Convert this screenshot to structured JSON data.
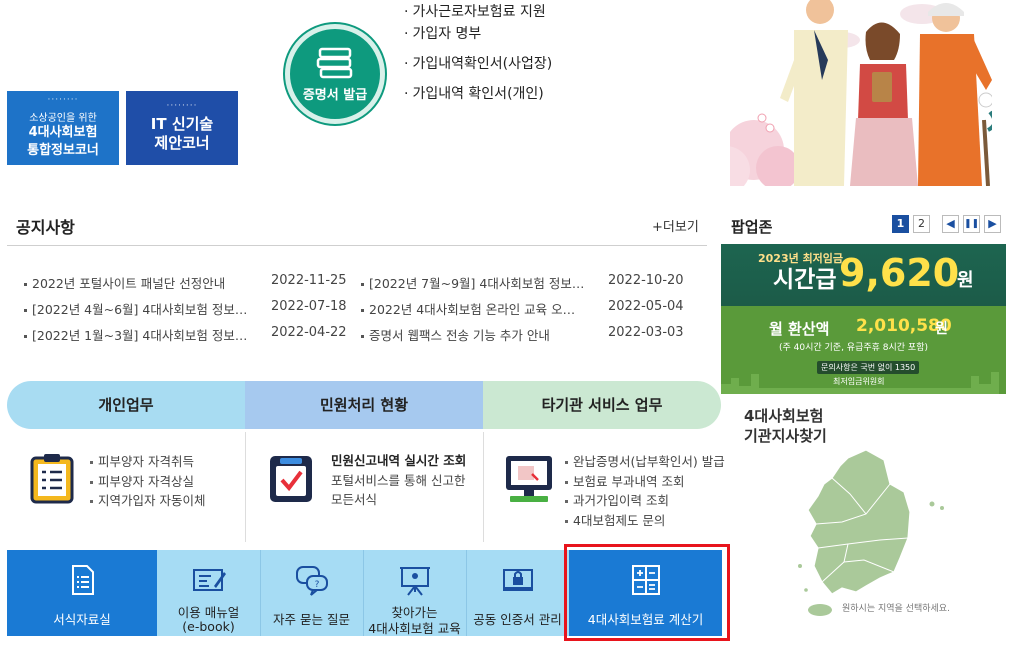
{
  "banners": [
    {
      "line1": "소상공인을 위한",
      "line2": "4대사회보험",
      "line3": "통합정보코너"
    },
    {
      "line1": "",
      "line2": "IT 신기술",
      "line3": "제안코너"
    }
  ],
  "certificate": {
    "circle_label": "증명서 발급",
    "items": [
      "가사근로자보험료 지원",
      "가입자 명부",
      "가입내역확인서(사업장)",
      "가입내역 확인서(개인)"
    ]
  },
  "notice": {
    "title": "공지사항",
    "more": "+더보기",
    "rows": [
      {
        "title": "2022년 포털사이트 패널단 선정안내",
        "date": "2022-11-25"
      },
      {
        "title": "[2022년 7월~9월] 4대사회보험 정보…",
        "date": "2022-10-20"
      },
      {
        "title": "[2022년 4월~6월] 4대사회보험 정보…",
        "date": "2022-07-18"
      },
      {
        "title": "2022년 4대사회보험 온라인 교육 오…",
        "date": "2022-05-04"
      },
      {
        "title": "[2022년 1월~3월] 4대사회보험 정보…",
        "date": "2022-04-22"
      },
      {
        "title": "증명서 웹팩스 전송 기능 추가 안내",
        "date": "2022-03-03"
      }
    ]
  },
  "popup": {
    "title": "팝업존",
    "page1": "1",
    "page2": "2",
    "prev": "◀",
    "pause": "❚❚",
    "next": "▶",
    "banner": {
      "year": "2023년 최저임금",
      "hourly_label": "시간급",
      "hourly_value": "9,620",
      "unit": "원",
      "monthly_label": "월 환산액",
      "monthly_value": "2,010,580",
      "monthly_unit": "원",
      "note": "(주 40시간 기준, 유급주휴 8시간 포함)",
      "inquiry": "문의사항은 국번 없이 1350",
      "org": "최저임금위원회"
    }
  },
  "map": {
    "title_line1": "4대사회보험",
    "title_line2": "기관지사찾기",
    "hint": "원하시는 지역을 선택하세요."
  },
  "business": {
    "tabs": [
      "개인업무",
      "민원처리 현황",
      "타기관 서비스 업무"
    ],
    "personal": [
      "피부양자 자격취득",
      "피부양자 자격상실",
      "지역가입자 자동이체"
    ],
    "civil": {
      "heading": "민원신고내역 실시간 조회",
      "line2": "포털서비스를 통해 신고한",
      "line3": "모든서식"
    },
    "other": [
      "완납증명서(납부확인서) 발급",
      "보험료 부과내역 조회",
      "과거가입이력 조회",
      "4대보험제도 문의"
    ]
  },
  "quick_menu": [
    {
      "line1": "서식자료실",
      "line2": ""
    },
    {
      "line1": "이용 매뉴얼",
      "line2": "(e-book)"
    },
    {
      "line1": "자주 묻는 질문",
      "line2": ""
    },
    {
      "line1": "찾아가는",
      "line2": "4대사회보험 교육"
    },
    {
      "line1": "공동 인증서 관리",
      "line2": ""
    },
    {
      "line1": "4대사회보험료 계산기",
      "line2": ""
    }
  ],
  "colors": {
    "primary_blue": "#1a7ad4",
    "light_blue": "#a6dcf4",
    "green": "#0e9a7e",
    "highlight_red": "#e8141c"
  }
}
